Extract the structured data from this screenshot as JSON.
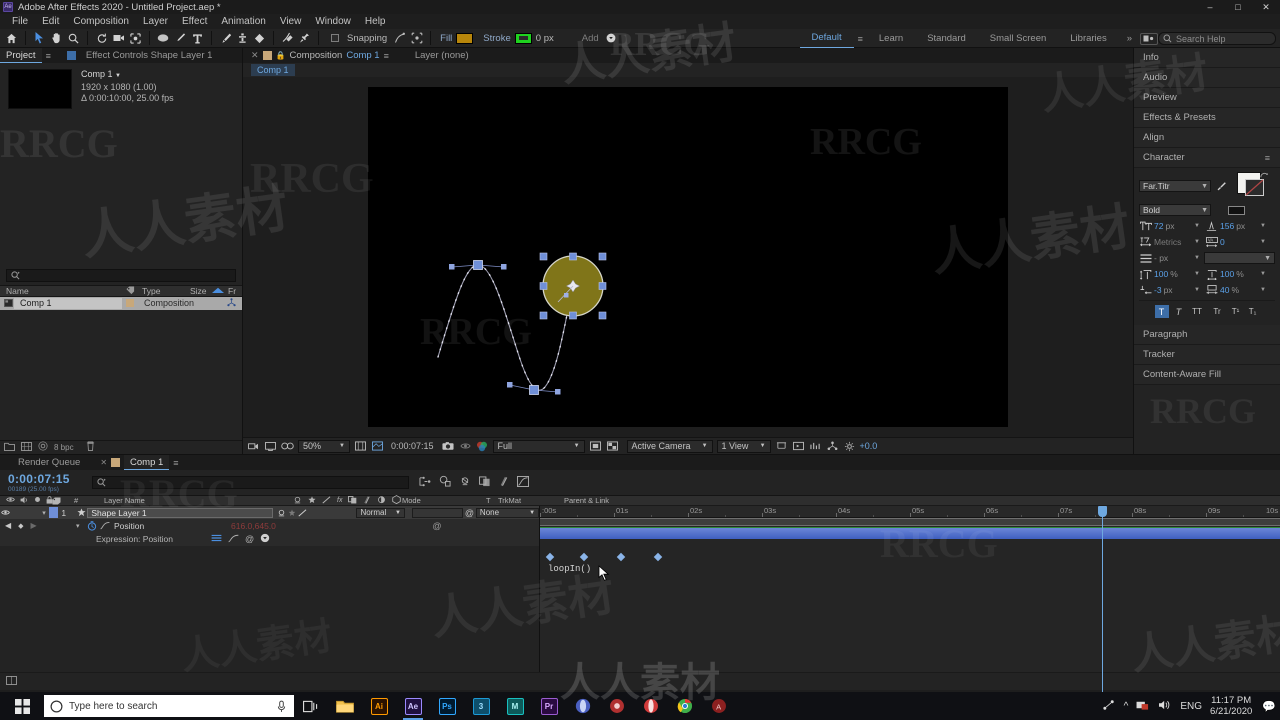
{
  "window": {
    "title": "Adobe After Effects 2020 - Untitled Project.aep *",
    "app_badge": "Ae",
    "minimize": "–",
    "maximize": "□",
    "close": "✕"
  },
  "menu": [
    "File",
    "Edit",
    "Composition",
    "Layer",
    "Effect",
    "Animation",
    "View",
    "Window",
    "Help"
  ],
  "toolbar": {
    "tools": [
      "home-icon",
      "selection-tool",
      "hand-tool",
      "zoom-tool",
      "orbit-tool",
      "camera-tool",
      "pan-behind-tool",
      "shape-tool",
      "pen-tool",
      "type-tool",
      "brush-tool",
      "clone-stamp-tool",
      "eraser-tool",
      "roto-brush-tool",
      "puppet-pin-tool"
    ],
    "snapping_label": "Snapping",
    "fill_label": "Fill",
    "fill_color": "#b8860b",
    "stroke_label": "Stroke",
    "stroke_color": "#1fd21f",
    "stroke_width": "0 px",
    "add_label": "Add",
    "workspaces": [
      "Default",
      "Learn",
      "Standard",
      "Small Screen",
      "Libraries"
    ],
    "workspace_active": "Default",
    "overflow": "»",
    "search_placeholder": "Search Help"
  },
  "project": {
    "tabs": [
      {
        "label": "Project",
        "active": true
      },
      {
        "label": "Effect Controls Shape Layer 1",
        "active": false
      }
    ],
    "comp_name": "Comp 1",
    "comp_res": "1920 x 1080 (1.00)",
    "comp_duration": "Δ 0:00:10:00, 25.00 fps",
    "search_placeholder": "",
    "columns": [
      "Name",
      "Type",
      "Size",
      "Fr"
    ],
    "items": [
      {
        "name": "Comp 1",
        "type": "Composition",
        "size": "",
        "selected": true
      }
    ],
    "footer_info": "8 bpc"
  },
  "viewer": {
    "tab_label": "Composition",
    "tab_comp": "Comp 1",
    "layer_label": "Layer (none)",
    "breadcrumb": "Comp 1",
    "zoom": "50%",
    "time": "0:00:07:15",
    "resolution": "Full",
    "camera": "Active Camera",
    "views": "1 View",
    "exposure": "+0.0"
  },
  "canvas": {
    "shape_fill": "#807519",
    "shape_stroke": "#d6d6c8",
    "path_color": "#b8b8cf",
    "handle_color": "#6f8fd8"
  },
  "right_panels": {
    "items": [
      "Info",
      "Audio",
      "Preview",
      "Effects & Presets",
      "Align"
    ],
    "character_title": "Character",
    "paragraph_title": "Paragraph",
    "tracker_title": "Tracker",
    "content_aware_title": "Content-Aware Fill"
  },
  "character": {
    "font_family": "Far.Titr",
    "font_style": "Bold",
    "font_size": "72",
    "font_size_unit": "px",
    "leading": "156",
    "leading_unit": "px",
    "kerning": "Metrics",
    "tracking": "0",
    "stroke_width": "- px",
    "stroke_style": "",
    "vertical_scale": "100",
    "vertical_scale_unit": "%",
    "horizontal_scale": "100",
    "horizontal_scale_unit": "%",
    "baseline_shift": "-3",
    "baseline_shift_unit": "px",
    "tsume": "40",
    "tsume_unit": "%",
    "style_buttons": [
      "T",
      "T",
      "TT",
      "Tr",
      "T¹",
      "T₁"
    ],
    "style_active_index": 0
  },
  "timeline": {
    "tabs": [
      {
        "label": "Render Queue",
        "active": false
      },
      {
        "label": "Comp 1",
        "active": true
      }
    ],
    "current_time": "0:00:07:15",
    "current_frame": "00189 (25.00 fps)",
    "search_placeholder": "",
    "columns": [
      "Layer Name",
      "Mode",
      "T",
      "TrkMat",
      "Parent & Link"
    ],
    "layers": [
      {
        "index": "1",
        "name": "Shape Layer 1",
        "mode": "Normal",
        "trkmat": "",
        "parent": "None",
        "color": "#6f8fd8"
      }
    ],
    "property": {
      "name": "Position",
      "value": "616.0,645.0",
      "expression_label": "Expression: Position",
      "expression_text": "loopIn()"
    },
    "ruler_ticks": [
      ":00s",
      "01s",
      "02s",
      "03s",
      "04s",
      "05s",
      "06s",
      "07s",
      "08s",
      "09s",
      "10s"
    ],
    "keyframe_times": [
      0.1,
      0.55,
      1.05,
      1.55
    ]
  },
  "taskbar": {
    "search_placeholder": "Type here to search",
    "apps": [
      {
        "name": "task-view-icon",
        "label": "",
        "color": "#0f1014"
      },
      {
        "name": "file-explorer-icon",
        "label": "",
        "color": "#e8b44c"
      },
      {
        "name": "illustrator-icon",
        "label": "Ai",
        "color": "#331a02"
      },
      {
        "name": "after-effects-icon",
        "label": "Ae",
        "color": "#2c1a5c"
      },
      {
        "name": "photoshop-icon",
        "label": "Ps",
        "color": "#031c33"
      },
      {
        "name": "3ds-max-icon",
        "label": "3",
        "color": "#1c9ad6"
      },
      {
        "name": "maya-icon",
        "label": "M",
        "color": "#13a0a0"
      },
      {
        "name": "premiere-icon",
        "label": "Pr",
        "color": "#2a0a40"
      },
      {
        "name": "opera-icon",
        "label": "",
        "color": "#2b3f8c"
      },
      {
        "name": "chrome-alt-icon",
        "label": "",
        "color": "#c33"
      },
      {
        "name": "browser-icon",
        "label": "",
        "color": "#d63333"
      },
      {
        "name": "chrome-icon",
        "label": "",
        "color": "#2b8a3e"
      },
      {
        "name": "app-icon",
        "label": "",
        "color": "#a02020"
      }
    ],
    "language": "ENG",
    "time": "11:17 PM",
    "date": "6/21/2020"
  },
  "watermark": {
    "text_cn": "人人素材",
    "text_en": "RRCG"
  }
}
